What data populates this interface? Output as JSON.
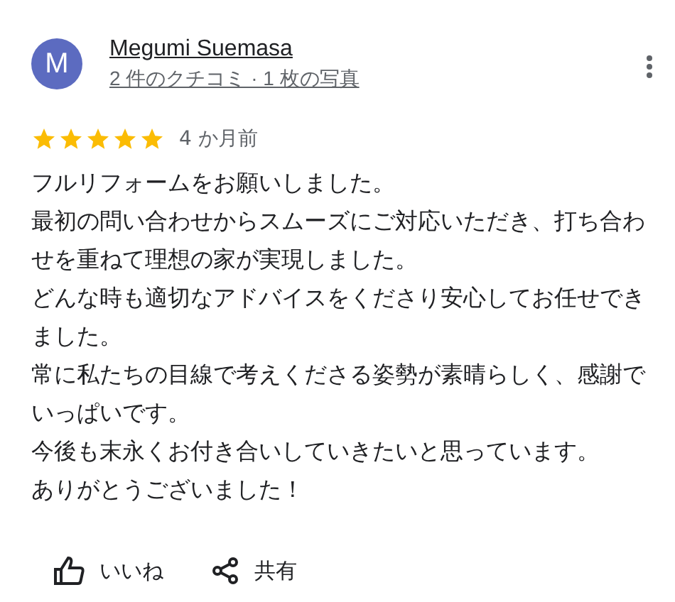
{
  "review": {
    "avatar_letter": "M",
    "author": "Megumi Suemasa",
    "meta": "2 件のクチコミ · 1 枚の写真",
    "stars": 5,
    "time": "4 か月前",
    "paragraphs": [
      "フルリフォームをお願いしました。",
      "最初の問い合わせからスムーズにご対応いただき、打ち合わせを重ねて理想の家が実現しました。",
      "どんな時も適切なアドバイスをくださり安心してお任せできました。",
      "常に私たちの目線で考えくださる姿勢が素晴らしく、感謝でいっぱいです。",
      "今後も末永くお付き合いしていきたいと思っています。",
      "ありがとうございました！"
    ],
    "actions": [
      {
        "kind": "like",
        "label": "いいね"
      },
      {
        "kind": "share",
        "label": "共有"
      }
    ]
  }
}
